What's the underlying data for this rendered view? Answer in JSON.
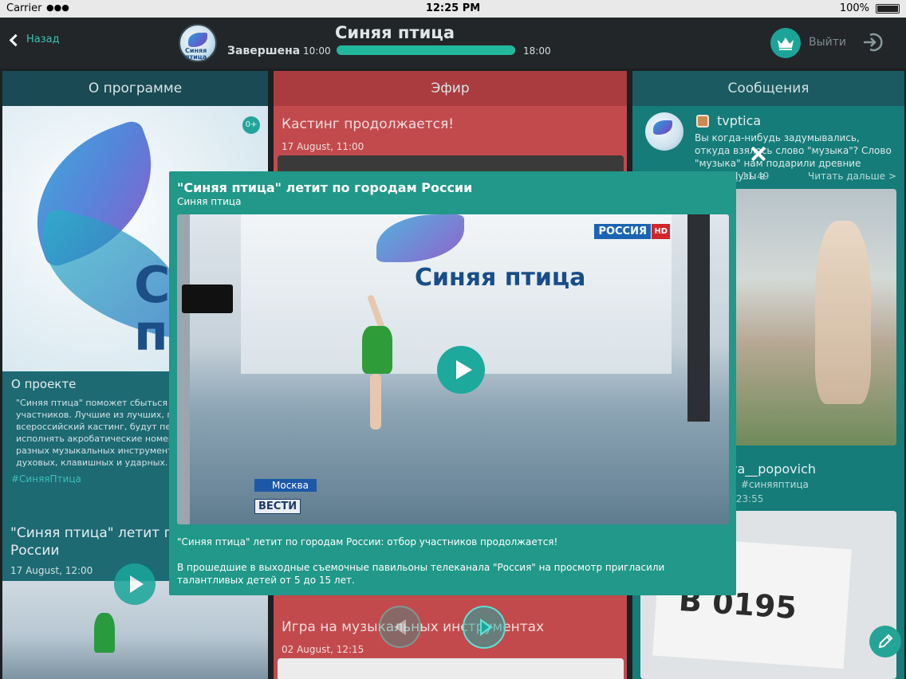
{
  "statusbar": {
    "carrier": "Carrier",
    "time": "12:25 PM",
    "battery": "100%"
  },
  "header": {
    "back_label": "Назад",
    "title": "Синяя птица",
    "logo_text": "Синяя птица",
    "status": "Завершена",
    "time_start": "10:00",
    "time_end": "18:00",
    "progress": 1.0,
    "logout_label": "Выйти"
  },
  "col_about": {
    "heading": "О программе",
    "age_badge": "0+",
    "section_title": "О проекте",
    "text": "\"Синяя птица\" поможет сбыться мечтам участников. Лучшие из лучших, прошедшие всероссийский кастинг, будут петь, танцевать, исполнять акробатические номера, играть на разных музыкальных инструментах, в том числе духовых, клавишных и ударных.",
    "hashtag": "#СиняяПтица",
    "news_title": "\"Синяя птица\" летит по городам России",
    "news_date": "17 August, 12:00"
  },
  "col_live": {
    "heading": "Эфир",
    "post1_title": "Кастинг продолжается!",
    "post1_date": "17 August, 11:00",
    "post2_title": "Игра на музыкальных инструментах",
    "post2_date": "02 August, 12:15"
  },
  "col_messages": {
    "heading": "Сообщения",
    "msg1_user": "tvptica",
    "msg1_text": "Вы когда-нибудь задумывались, откуда взялось слово \"музыка\"? Слово \"музыка\" нам подарили древние греки. Музы в",
    "msg1_time": "| 11:49",
    "read_more": "Читать дальше >",
    "msg2_user": "ya__popovich",
    "msg2_tag": "#синяяптица",
    "msg2_time": "| 23:55",
    "msg2_number": "B 0195"
  },
  "modal": {
    "title": "\"Синяя птица\" летит по городам России",
    "subtitle": "Синяя птица",
    "channel": "РОССИЯ",
    "channel_hd": "HD",
    "city": "Москва",
    "program": "ВЕСТИ",
    "stage_logo": "Синяя птица",
    "description": "\"Синяя птица\" летит по городам России: отбор участников продолжается!",
    "body": "В прошедшие в выходные съемочные павильоны телеканала \"Россия\" на просмотр пригласили талантливых детей от 5 до 15 лет."
  },
  "icons": {
    "back": "chevron-left-icon",
    "crown": "crown-icon",
    "logout": "logout-icon",
    "close": "close-icon",
    "play": "play-icon",
    "edit": "pencil-icon",
    "instagram": "instagram-icon"
  },
  "colors": {
    "accent": "#22b89e",
    "about_column": "#1d6a73",
    "live_column": "#c24a4d",
    "messages_column": "#157c79",
    "modal": "#219889"
  }
}
